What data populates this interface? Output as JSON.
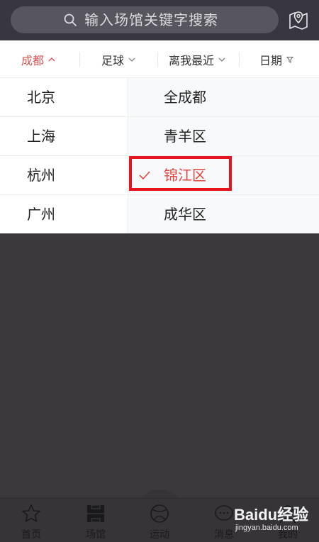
{
  "search": {
    "placeholder": "输入场馆关键字搜索"
  },
  "filters": {
    "city": "成都",
    "sport": "足球",
    "sort": "离我最近",
    "date": "日期"
  },
  "cities": [
    "北京",
    "上海",
    "杭州",
    "广州"
  ],
  "districts": [
    "全成都",
    "青羊区",
    "锦江区",
    "成华区"
  ],
  "selected_district_index": 2,
  "tabs": [
    "首页",
    "场馆",
    "运动",
    "消息",
    "我的"
  ],
  "watermark": {
    "brand": "Baidu经验",
    "url": "jingyan.baidu.com"
  },
  "colors": {
    "accent": "#e64541",
    "highlight": "#e6141e",
    "overlay": "#3b393d"
  }
}
